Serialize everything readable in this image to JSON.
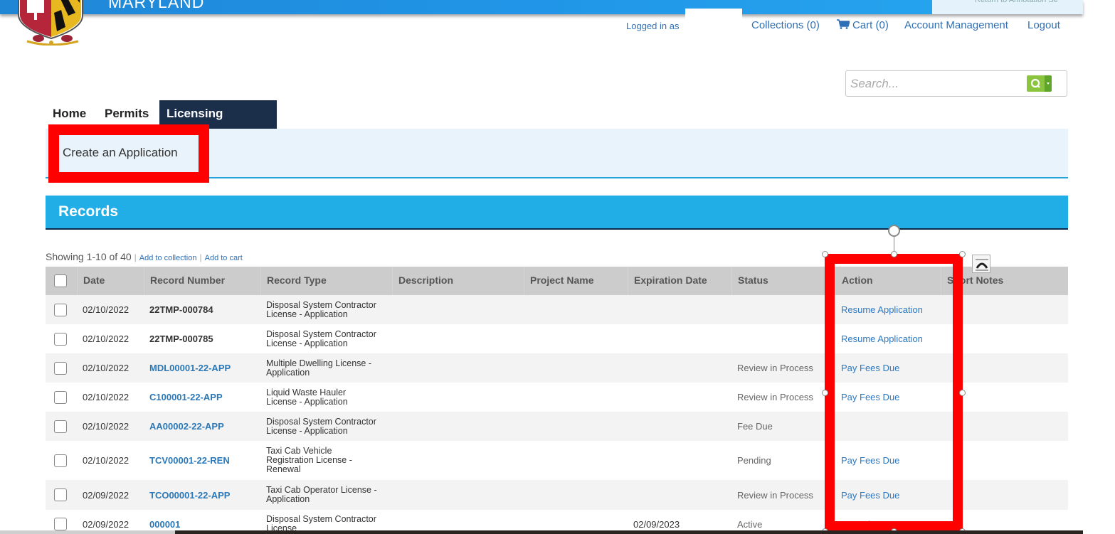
{
  "header": {
    "brand": "MARYLAND",
    "banner_right_text": "Return to Annotation Se",
    "logged_in_label": "Logged in as",
    "links": [
      {
        "label": "Collections (0)"
      },
      {
        "label": "Cart (0)",
        "icon": "cart-icon"
      },
      {
        "label": "Account Management"
      },
      {
        "label": "Logout"
      }
    ]
  },
  "search": {
    "placeholder": "Search...",
    "button_icon": "search-icon",
    "dropdown_icon": "caret-down-icon"
  },
  "nav": {
    "tabs": [
      {
        "label": "Home",
        "active": false
      },
      {
        "label": "Permits",
        "active": false
      },
      {
        "label": "Licensing",
        "active": true
      }
    ],
    "sub_items": [
      {
        "label": "Create an Application"
      }
    ]
  },
  "records": {
    "title": "Records",
    "showing": "Showing 1-10 of 40",
    "add_to_collection": "Add to collection",
    "add_to_cart": "Add to cart",
    "columns": [
      "Date",
      "Record Number",
      "Record Type",
      "Description",
      "Project Name",
      "Expiration Date",
      "Status",
      "Action",
      "Short Notes"
    ],
    "rows": [
      {
        "date": "02/10/2022",
        "record_number": "22TMP-000784",
        "record_link": false,
        "record_type": [
          "Disposal System Contractor",
          "License - Application"
        ],
        "description": "",
        "project_name": "",
        "expiration_date": "",
        "status": "",
        "action": "Resume Application",
        "short_notes": ""
      },
      {
        "date": "02/10/2022",
        "record_number": "22TMP-000785",
        "record_link": false,
        "record_type": [
          "Disposal System Contractor",
          "License - Application"
        ],
        "description": "",
        "project_name": "",
        "expiration_date": "",
        "status": "",
        "action": "Resume Application",
        "short_notes": ""
      },
      {
        "date": "02/10/2022",
        "record_number": "MDL00001-22-APP",
        "record_link": true,
        "record_type": [
          "Multiple Dwelling License -",
          "Application"
        ],
        "description": "",
        "project_name": "",
        "expiration_date": "",
        "status": "Review in Process",
        "action": "Pay Fees Due",
        "short_notes": ""
      },
      {
        "date": "02/10/2022",
        "record_number": "C100001-22-APP",
        "record_link": true,
        "record_type": [
          "Liquid Waste Hauler",
          "License - Application"
        ],
        "description": "",
        "project_name": "",
        "expiration_date": "",
        "status": "Review in Process",
        "action": "Pay Fees Due",
        "short_notes": ""
      },
      {
        "date": "02/10/2022",
        "record_number": "AA00002-22-APP",
        "record_link": true,
        "record_type": [
          "Disposal System Contractor",
          "License - Application"
        ],
        "description": "",
        "project_name": "",
        "expiration_date": "",
        "status": "Fee Due",
        "action": "",
        "short_notes": ""
      },
      {
        "date": "02/10/2022",
        "record_number": "TCV00001-22-REN",
        "record_link": true,
        "record_type": [
          "Taxi Cab Vehicle",
          "Registration License -",
          "Renewal"
        ],
        "description": "",
        "project_name": "",
        "expiration_date": "",
        "status": "Pending",
        "action": "Pay Fees Due",
        "short_notes": ""
      },
      {
        "date": "02/09/2022",
        "record_number": "TCO00001-22-APP",
        "record_link": true,
        "record_type": [
          "Taxi Cab Operator License -",
          "Application"
        ],
        "description": "",
        "project_name": "",
        "expiration_date": "",
        "status": "Review in Process",
        "action": "Pay Fees Due",
        "short_notes": ""
      },
      {
        "date": "02/09/2022",
        "record_number": "000001",
        "record_link": true,
        "record_type": [
          "Disposal System Contractor",
          "License"
        ],
        "description": "",
        "project_name": "",
        "expiration_date": "02/09/2023",
        "status": "Active",
        "action": "Amendment",
        "short_notes": ""
      }
    ]
  },
  "annotations": {
    "highlight_color": "#ff0000",
    "highlighted": [
      "Create an Application",
      "Action column"
    ]
  },
  "colors": {
    "banner": "#2196e8",
    "records_bar": "#21ade6",
    "active_tab": "#1c2f4a",
    "link": "#2e6fb5",
    "search_button": "#8bc53f"
  }
}
